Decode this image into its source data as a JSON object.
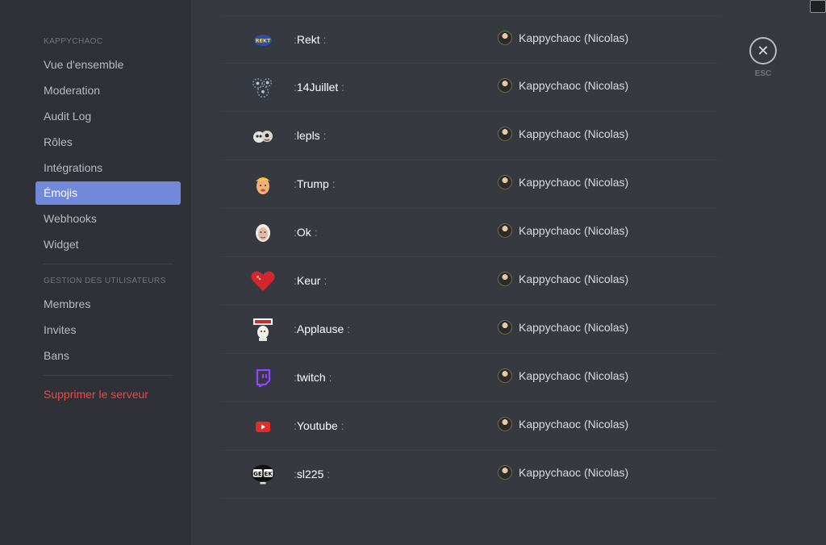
{
  "sidebar": {
    "server_header": "KAPPYCHAOC",
    "items": [
      {
        "label": "Vue d'ensemble"
      },
      {
        "label": "Moderation"
      },
      {
        "label": "Audit Log"
      },
      {
        "label": "Rôles"
      },
      {
        "label": "Intégrations"
      },
      {
        "label": "Émojis"
      },
      {
        "label": "Webhooks"
      },
      {
        "label": "Widget"
      }
    ],
    "user_header": "GESTION DES UTILISATEURS",
    "user_items": [
      {
        "label": "Membres"
      },
      {
        "label": "Invites"
      },
      {
        "label": "Bans"
      }
    ],
    "delete_label": "Supprimer le serveur"
  },
  "emojis": [
    {
      "name": "Rekt",
      "icon": "rekt-emoji-icon",
      "uploader": "Kappychaoc (Nicolas)"
    },
    {
      "name": "14Juillet",
      "icon": "fireworks-emoji-icon",
      "uploader": "Kappychaoc (Nicolas)"
    },
    {
      "name": "lepls",
      "icon": "lepls-emoji-icon",
      "uploader": "Kappychaoc (Nicolas)"
    },
    {
      "name": "Trump",
      "icon": "trump-emoji-icon",
      "uploader": "Kappychaoc (Nicolas)"
    },
    {
      "name": "Ok",
      "icon": "ok-emoji-icon",
      "uploader": "Kappychaoc (Nicolas)"
    },
    {
      "name": "Keur",
      "icon": "pixel-heart-emoji-icon",
      "uploader": "Kappychaoc (Nicolas)"
    },
    {
      "name": "Applause",
      "icon": "applause-emoji-icon",
      "uploader": "Kappychaoc (Nicolas)"
    },
    {
      "name": "twitch",
      "icon": "twitch-emoji-icon",
      "uploader": "Kappychaoc (Nicolas)"
    },
    {
      "name": "Youtube",
      "icon": "youtube-emoji-icon",
      "uploader": "Kappychaoc (Nicolas)"
    },
    {
      "name": "sl225",
      "icon": "geek-emoji-icon",
      "uploader": "Kappychaoc (Nicolas)"
    }
  ],
  "close": {
    "label": "ESC"
  },
  "colors": {
    "accent": "#7289da",
    "danger": "#f04747",
    "background": "#36393f",
    "sidebar": "#2f3136"
  }
}
